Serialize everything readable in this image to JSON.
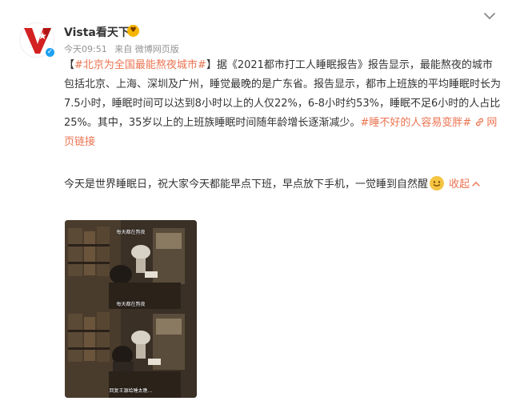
{
  "post": {
    "username": "Vista看天下",
    "time": "今天09:51",
    "source": "来自 微博网页版",
    "paragraph1": {
      "bracket_open": "【",
      "hashtag": "#北京为全国最能熬夜城市#",
      "bracket_close": "】",
      "text": "据《2021都市打工人睡眠报告》报告显示，最能熬夜的城市包括北京、上海、深圳及广州，睡觉最晚的是广东省。报告显示，都市上班族的平均睡眠时长为7.5小时，睡眠时间可以达到8小时以上的人仅22%，6-8小时约53%，睡眠不足6小时的人占比25%。其中，35岁以上的上班族睡眠时间随年龄增长逐渐减少。",
      "hashtag2": "#睡不好的人容易变胖#",
      "link_label": "网页链接"
    },
    "paragraph2": {
      "text": "今天是世界睡眠日，祝大家今天都能早点下班，早点放下手机，一觉睡到自然醒",
      "collapse_label": "收起"
    },
    "image": {
      "captions": [
        "每天都在熬夜",
        "每天都在熬夜",
        "回复王源给睡太晚…"
      ]
    }
  },
  "icons": {
    "avatar": "vista-logo-icon",
    "verified": "verified-badge-icon",
    "emoji": "heart-eyes-emoji-icon",
    "chevron": "chevron-down-icon",
    "link": "link-icon",
    "smile": "smile-emoji-icon",
    "collapse_arrow": "chevron-up-icon"
  },
  "colors": {
    "accent": "#eb7350",
    "text": "#333333",
    "meta": "#939393",
    "logo_red": "#d32121"
  }
}
